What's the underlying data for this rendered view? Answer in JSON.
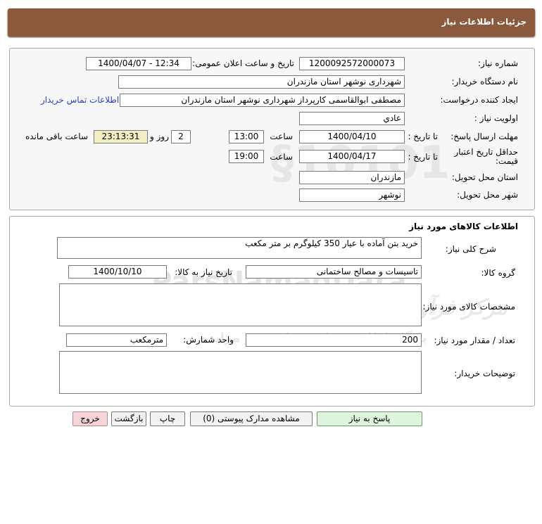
{
  "header": {
    "title": "جزئیات اطلاعات نیاز"
  },
  "info": {
    "need_number_label": "شماره نیاز:",
    "need_number": "1200092572000073",
    "announce_label": "تاریخ و ساعت اعلان عمومی:",
    "announce_value": "1400/04/07 - 12:34",
    "buyer_org_label": "نام دستگاه خریدار:",
    "buyer_org": "شهرداری نوشهر استان مازندران",
    "creator_label": "ایجاد کننده درخواست:",
    "creator": "مصطفی  ابوالقاسمی کارپرداز شهرداری نوشهر استان مازندران",
    "contact_link": "اطلاعات تماس خریدار",
    "priority_label": "اولویت نیاز :",
    "priority": "عادي",
    "deadline_label": "مهلت ارسال پاسخ:",
    "until_date_label": "تا تاریخ :",
    "deadline_date": "1400/04/10",
    "time_label": "ساعت",
    "deadline_time": "13:00",
    "days_value": "2",
    "days_label": "روز و",
    "remaining_time": "23:13:31",
    "remaining_label": "ساعت باقی مانده",
    "validity_label": "حداقل تاریخ اعتبار قیمت:",
    "validity_date": "1400/04/17",
    "validity_time": "19:00",
    "province_label": "استان محل تحویل:",
    "province": "مازندران",
    "city_label": "شهر محل تحویل:",
    "city": "نوشهر"
  },
  "goods": {
    "title": "اطلاعات کالاهای مورد نیاز",
    "desc_label": "شرح کلی نیاز:",
    "desc": "خرید بتن آماده با عیار 350 کیلوگرم بر متر مکعب",
    "group_label": "گروه کالا:",
    "group": "تاسیسات و مصالح ساختمانی",
    "need_date_label": "تاریخ نیاز به کالا:",
    "need_date": "1400/10/10",
    "specs_label": "مشخصات کالای مورد نیاز:",
    "specs": "",
    "qty_label": "تعداد / مقدار مورد نیاز:",
    "qty": "200",
    "unit_label": "واحد شمارش:",
    "unit": "مترمکعب",
    "notes_label": "توضیحات خریدار:",
    "notes": ""
  },
  "buttons": {
    "reply": "پاسخ به نیاز",
    "attachments": "مشاهده مدارک پیوستی (0)",
    "print": "چاپ",
    "back": "بازگشت",
    "exit": "خروج"
  },
  "watermark": {
    "brand": "ParsNamadData",
    "line1": "مرکز فرآوری اطلاعات پارس نماد داده ها",
    "line2": "پایگاه اطلاع رسانی مناقصه و مزایده",
    "phone": "۰۲۱-۸۸۳۴۹۶۷۰-۵"
  }
}
